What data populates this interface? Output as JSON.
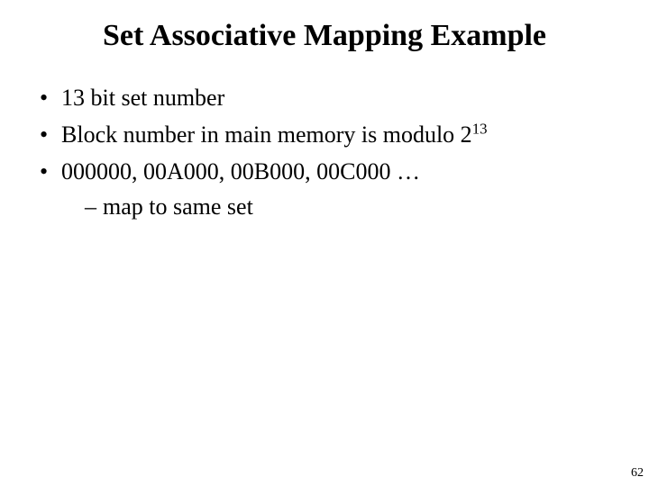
{
  "title": "Set Associative Mapping Example",
  "bullets": {
    "b1": "13 bit set number",
    "b2_pre": "Block number in main memory is modulo 2",
    "b2_exp": "13",
    "b3": "000000, 00A000, 00B000, 00C000 …",
    "sub1": "map to same set"
  },
  "page_number": "62"
}
